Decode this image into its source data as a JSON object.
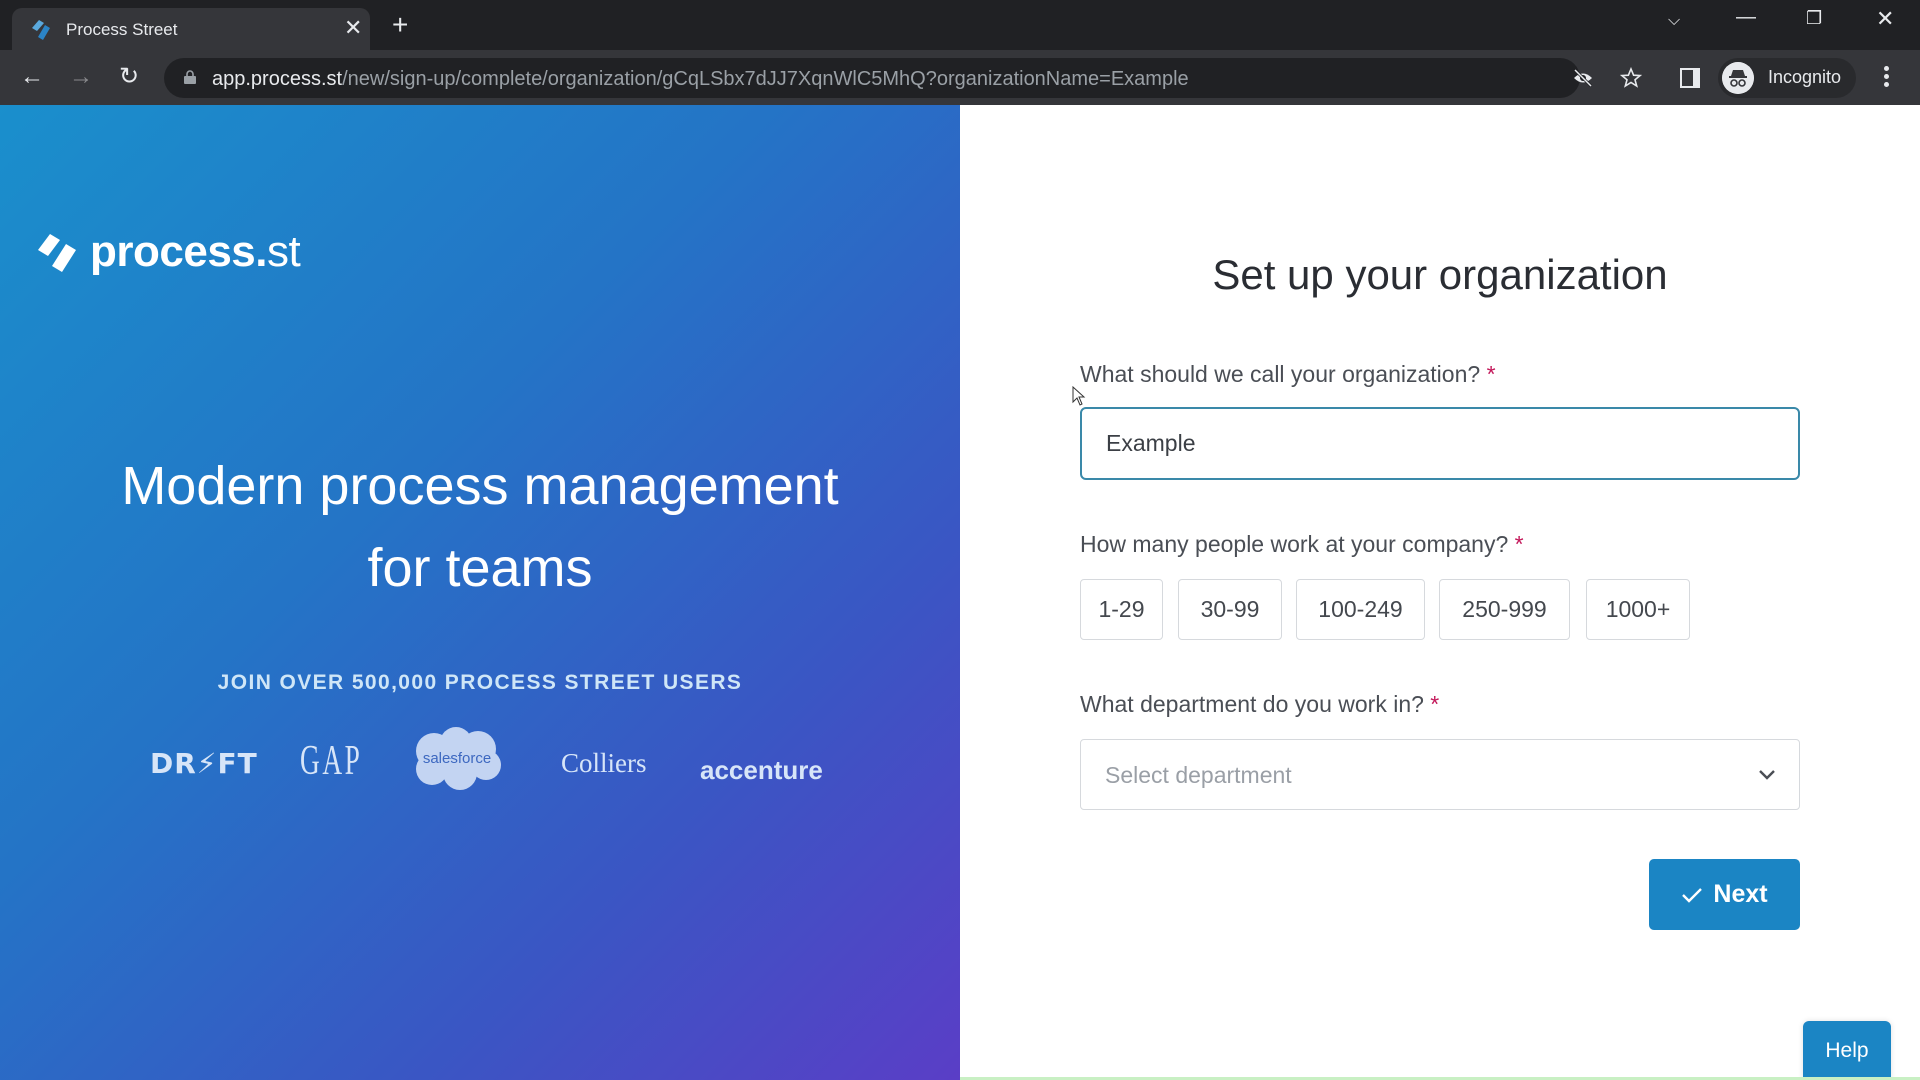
{
  "browser": {
    "tab_title": "Process Street",
    "tab_favicon": "process-street-logo-icon",
    "new_tab_label": "+",
    "url_host": "app.process.st",
    "url_path": "/new/sign-up/complete/organization/gCqLSbx7dJJ7XqnWlC5MhQ?organizationName=Example",
    "profile_label": "Incognito",
    "icons": [
      "back-arrow-icon",
      "forward-arrow-icon",
      "reload-icon",
      "lock-icon",
      "eye-off-icon",
      "star-icon",
      "side-panel-icon",
      "incognito-icon",
      "kebab-menu-icon",
      "tab-search-icon",
      "minimize-icon",
      "restore-icon",
      "close-icon"
    ]
  },
  "hero": {
    "logo_text_bold": "process.",
    "logo_text_light": "st",
    "title_line1": "Modern process management",
    "title_line2": "for teams",
    "subtitle": "JOIN OVER 500,000 PROCESS STREET USERS",
    "brands": [
      "DR⚡FT",
      "GAP",
      "salesforce",
      "Colliers",
      "accenture"
    ],
    "gradient": [
      "#1a8fcc",
      "#5a3ec6"
    ]
  },
  "form": {
    "title": "Set up your organization",
    "org_name": {
      "label": "What should we call your organization?",
      "required_mark": "*",
      "value": "Example"
    },
    "company_size": {
      "label": "How many people work at your company?",
      "required_mark": "*",
      "options": [
        "1-29",
        "30-99",
        "100-249",
        "250-999",
        "1000+"
      ]
    },
    "department": {
      "label": "What department do you work in?",
      "required_mark": "*",
      "placeholder": "Select department"
    },
    "next_label": "Next",
    "accent_color": "#1b85c4"
  },
  "help_label": "Help"
}
